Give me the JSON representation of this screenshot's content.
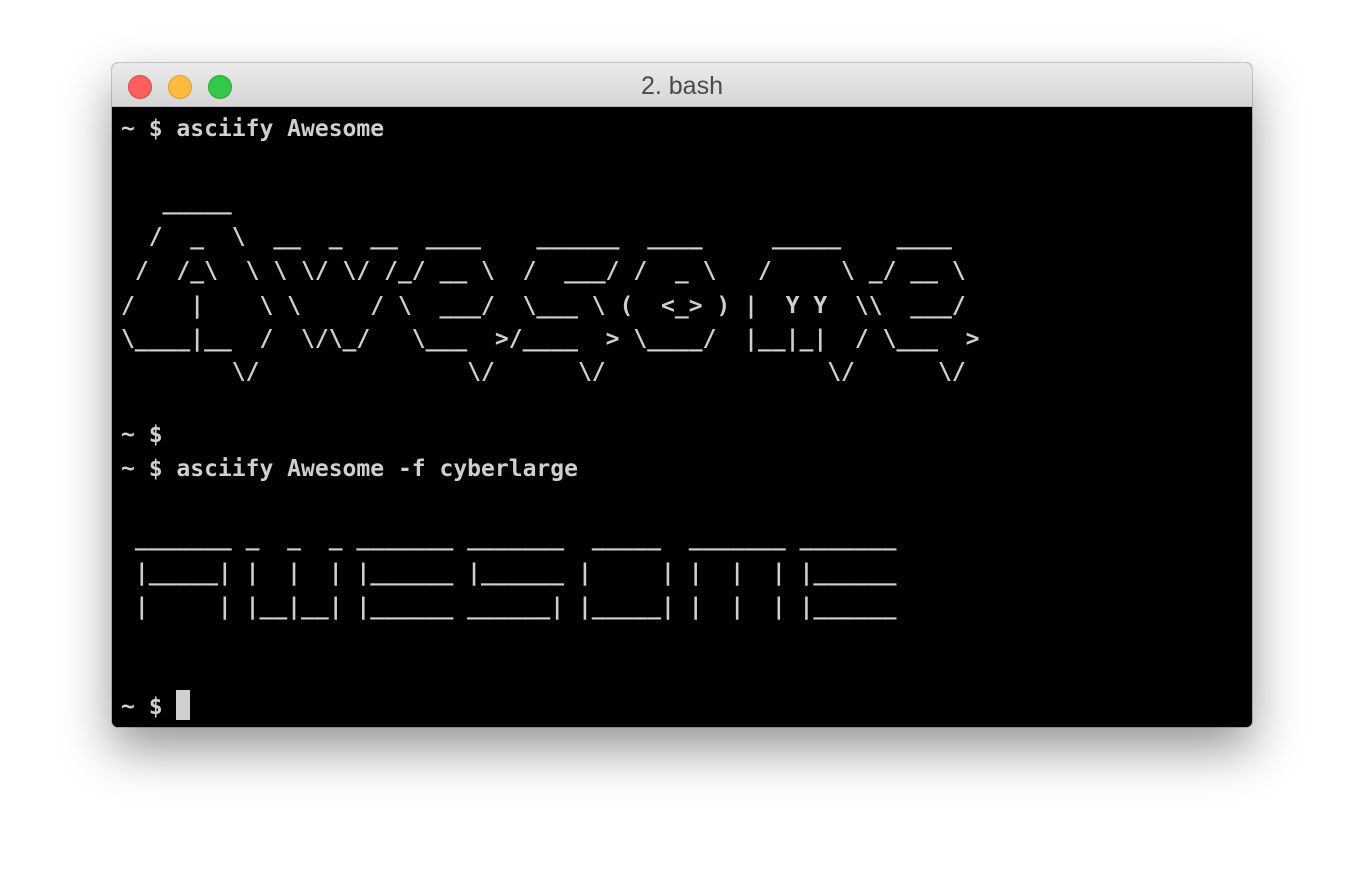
{
  "window": {
    "title": "2. bash"
  },
  "terminal": {
    "lines": [
      "~ $ asciify Awesome",
      "",
      "   _____",
      "  /  _  \\  __  _  __  ____    ______  ____     _____    ____",
      " /  /_\\  \\ \\ \\/ \\/ /_/ __ \\  /  ___/ /  _ \\   /     \\ _/ __ \\",
      "/    |    \\ \\     / \\  ___/  \\___ \\ (  <_> ) |  Y Y  \\\\  ___/",
      "\\____|__  /  \\/\\_/   \\___  >/____  > \\____/  |__|_|  / \\___  >",
      "        \\/               \\/      \\/                \\/      \\/",
      "",
      "~ $",
      "~ $ asciify Awesome -f cyberlarge",
      "",
      " _______ _  _  _ _______ _______  _____  _______ _______",
      " |_____| |  |  | |______ |______ |     | |  |  | |______",
      " |     | |__|__| |______ ______| |_____| |  |  | |______",
      "",
      "",
      "~ $ "
    ]
  }
}
